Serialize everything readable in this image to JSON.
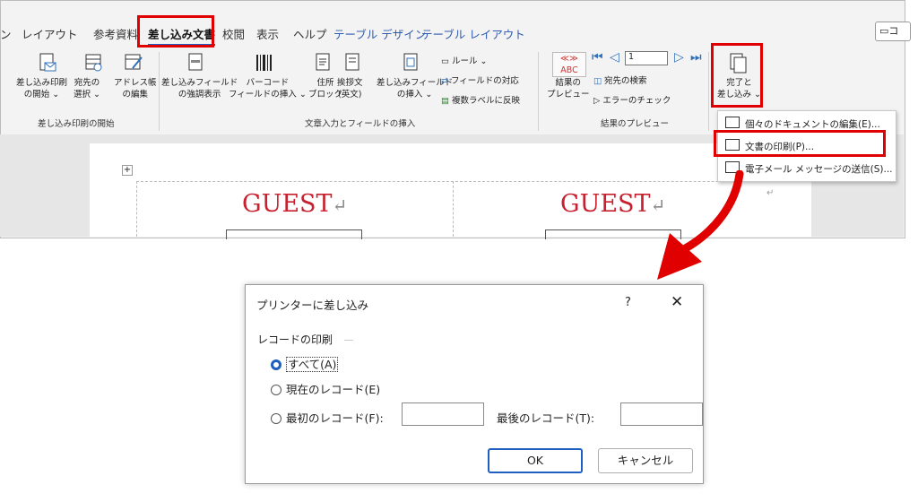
{
  "ribbon": {
    "tabs": [
      {
        "label": "ン"
      },
      {
        "label": "レイアウト"
      },
      {
        "label": "参考資料"
      },
      {
        "label": "差し込み文書"
      },
      {
        "label": "校閲"
      },
      {
        "label": "表示"
      },
      {
        "label": "ヘルプ"
      },
      {
        "label": "テーブル デザイン"
      },
      {
        "label": "テーブル レイアウト"
      }
    ],
    "comment_label": "コ",
    "buttons": {
      "start_merge": "差し込み印刷\nの開始 ⌄",
      "select_recipients": "宛先の\n選択 ⌄",
      "edit_list": "アドレス帳\nの編集",
      "highlight_fields": "差し込みフィールド\nの強調表示",
      "barcode": "バーコード\nフィールドの挿入 ⌄",
      "address_block": "住所\nブロック",
      "greeting": "挨拶文\n(英文)",
      "insert_field": "差し込みフィールド\nの挿入 ⌄",
      "rules": "ルール ⌄",
      "match_fields": "フィールドの対応",
      "update_labels": "複数ラベルに反映",
      "preview_results": "結果の\nプレビュー",
      "preview_abc": "≪≫\nABC",
      "record_number": "1",
      "find_recipient": "宛先の検索",
      "check_errors": "エラーのチェック",
      "finish_merge": "完了と\n差し込み ⌄"
    },
    "groups": {
      "start": "差し込み印刷の開始",
      "write_insert": "文章入力とフィールドの挿入",
      "preview": "結果のプレビュー"
    },
    "dropdown": {
      "edit_docs": "個々のドキュメントの編集(E)...",
      "print_docs": "文書の印刷(P)...",
      "send_email": "電子メール メッセージの送信(S)..."
    },
    "document": {
      "guest_left": "GUEST",
      "guest_right": "GUEST",
      "return_mark": "↵"
    }
  },
  "dialog": {
    "title": "プリンターに差し込み",
    "help": "?",
    "close": "✕",
    "group_label": "レコードの印刷",
    "options": {
      "all": "すべて(A)",
      "current": "現在のレコード(E)",
      "from": "最初のレコード(F):",
      "to": "最後のレコード(T):"
    },
    "from_value": "",
    "to_value": "",
    "ok": "OK",
    "cancel": "キャンセル"
  },
  "colors": {
    "highlight_red": "#e00000",
    "accent_blue": "#1f5fbf",
    "guest_red": "#c8202f"
  }
}
